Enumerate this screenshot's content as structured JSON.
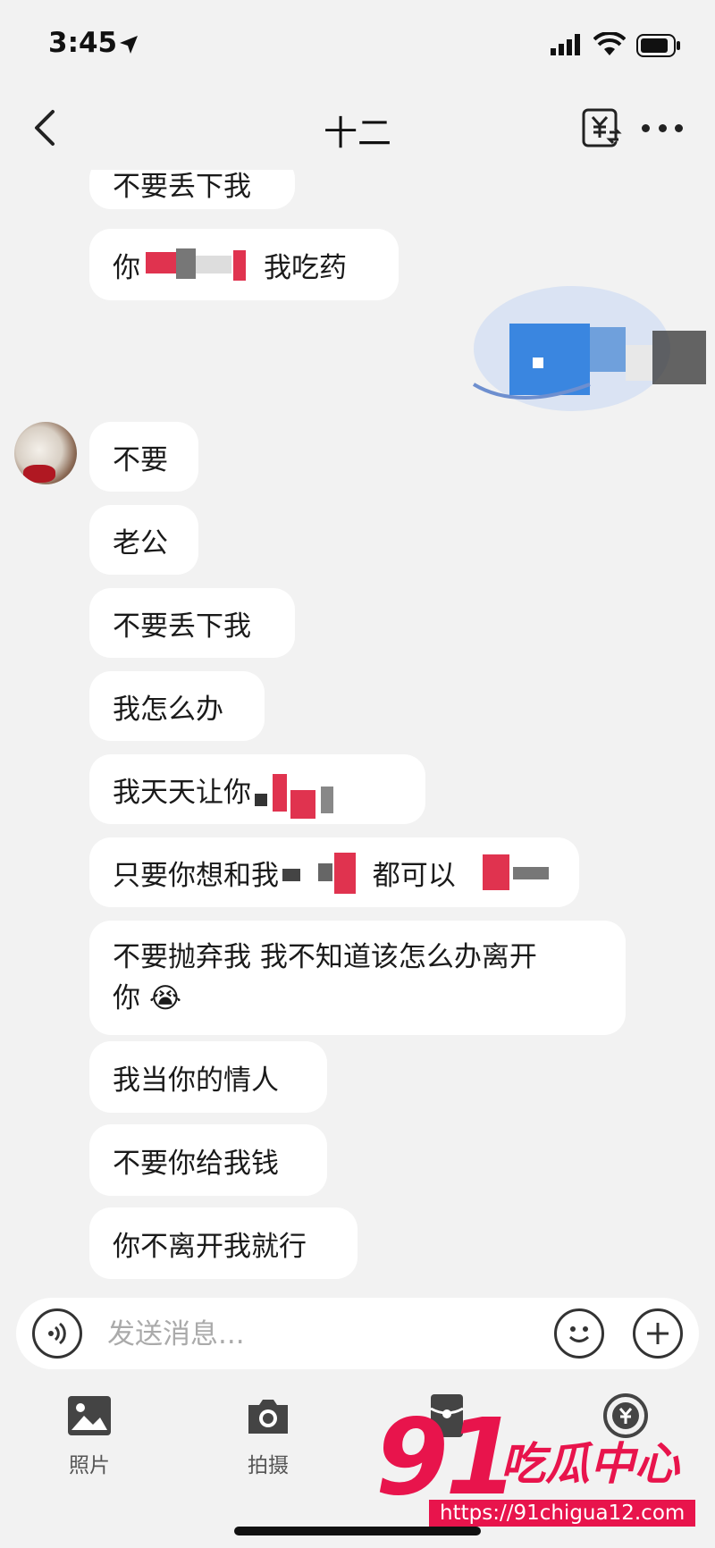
{
  "status_bar": {
    "time": "3:45"
  },
  "header": {
    "title": "十二"
  },
  "messages": [
    {
      "text": "不要丢下我"
    },
    {
      "text": "你",
      "tail": "我吃药"
    },
    {
      "text": "不要"
    },
    {
      "text": "老公"
    },
    {
      "text": "不要丢下我"
    },
    {
      "text": "我怎么办"
    },
    {
      "text": "我天天让你"
    },
    {
      "text": "只要你想和我",
      "mid": "都可以"
    },
    {
      "line1": "不要抛弃我 我不知道该怎么办离开",
      "line2": "你",
      "emoji": "😭"
    },
    {
      "text": "我当你的情人"
    },
    {
      "text": "不要你给我钱"
    },
    {
      "text": "你不离开我就行"
    }
  ],
  "input": {
    "placeholder": "发送消息..."
  },
  "toolbar": {
    "items": [
      {
        "label": "照片",
        "icon": "photo-icon"
      },
      {
        "label": "拍摄",
        "icon": "camera-icon"
      },
      {
        "label": "",
        "icon": "red-packet-icon"
      },
      {
        "label": "",
        "icon": "transfer-icon"
      }
    ]
  },
  "watermark": {
    "brand": "91",
    "name": "吃瓜中心",
    "url": "https://91chigua12.com"
  },
  "colors": {
    "background": "#f2f2f2",
    "bubble": "#ffffff",
    "watermark": "#e8144c",
    "censor_red": "#e0334f"
  }
}
